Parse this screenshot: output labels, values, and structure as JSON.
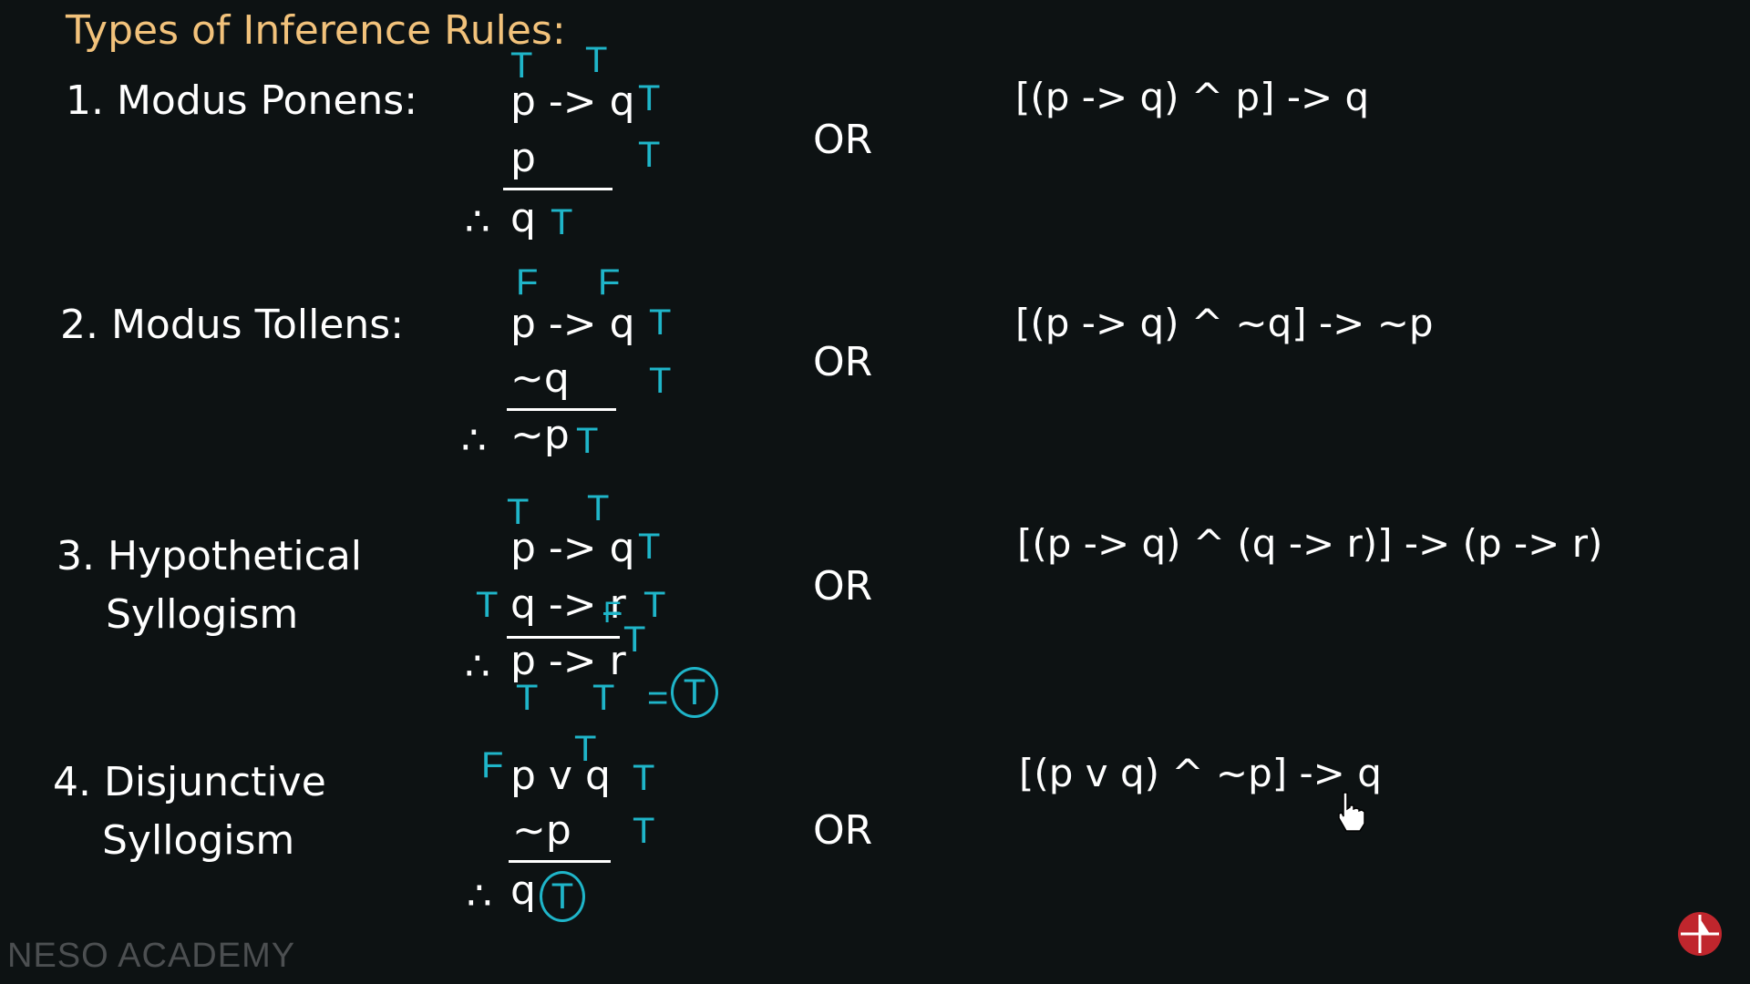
{
  "title": "Types of Inference Rules:",
  "rules": [
    {
      "name_lines": [
        "1. Modus Ponens:"
      ],
      "premise1": "p -> q",
      "premise2": "p",
      "conclusion": "q",
      "or_label": "OR",
      "formula": "[(p -> q) ^ p] -> q",
      "marks": {
        "p1_var1": "T",
        "p1_var2": "T",
        "p1_value": "T",
        "p2_value": "T",
        "conclusion_value": "T"
      }
    },
    {
      "name_lines": [
        "2. Modus Tollens:"
      ],
      "premise1": "p -> q",
      "premise2": "~q",
      "conclusion": "~p",
      "or_label": "OR",
      "formula": "[(p -> q) ^ ~q] -> ~p",
      "marks": {
        "p1_var1": "F",
        "p1_var2": "F",
        "p1_value": "T",
        "p2_value": "T",
        "conclusion_value": "T"
      }
    },
    {
      "name_lines": [
        "3. Hypothetical",
        "Syllogism"
      ],
      "premise1": "p -> q",
      "premise2": "q -> r",
      "conclusion": "p -> r",
      "or_label": "OR",
      "formula": "[(p -> q) ^ (q -> r)] -> (p -> r)",
      "marks": {
        "p1_var1": "T",
        "p1_var2": "T",
        "p1_value": "T",
        "p2_left": "T",
        "p2_value": "T",
        "struck": "F",
        "fix": "T",
        "c_var1": "T",
        "c_var2": "T",
        "equals": "=",
        "result": "T"
      }
    },
    {
      "name_lines": [
        "4. Disjunctive",
        "Syllogism"
      ],
      "premise1": "p v q",
      "premise2": "~p",
      "conclusion": "q",
      "or_label": "OR",
      "formula": "[(p v q) ^ ~p] -> q",
      "marks": {
        "p1_left": "F",
        "p1_var2": "T",
        "p1_value": "T",
        "p2_value": "T",
        "result": "T"
      }
    }
  ],
  "therefore_symbol": "∴",
  "brand": "NESO ACADEMY",
  "colors": {
    "background": "#0d1213",
    "title": "#f2c27b",
    "annotation": "#1fb5c9",
    "text": "#ffffff",
    "logo": "#c0262d"
  }
}
